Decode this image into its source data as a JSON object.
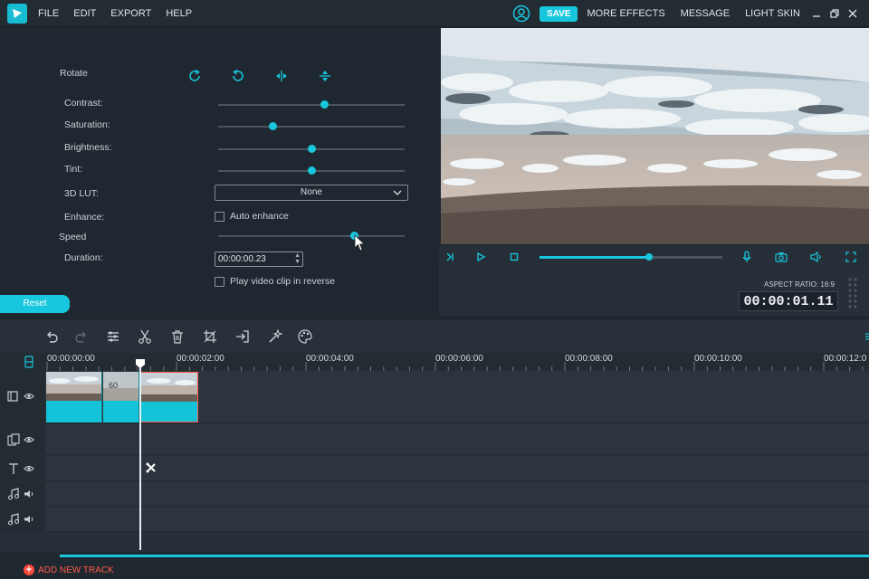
{
  "app": {
    "menu": [
      "FILE",
      "EDIT",
      "EXPORT",
      "HELP"
    ],
    "save_label": "SAVE",
    "links": [
      "MORE EFFECTS",
      "MESSAGE",
      "LIGHT SKIN"
    ],
    "accent": "#18c7dd"
  },
  "panel": {
    "rotate_label": "Rotate",
    "rotate_icons": [
      "rotate-cw-icon",
      "rotate-ccw-icon",
      "flip-horizontal-icon",
      "flip-vertical-icon"
    ],
    "sliders": [
      {
        "label": "Contrast:",
        "value": 0.57
      },
      {
        "label": "Saturation:",
        "value": 0.29
      },
      {
        "label": "Brightness:",
        "value": 0.5
      },
      {
        "label": "Tint:",
        "value": 0.5
      }
    ],
    "lut_label": "3D LUT:",
    "lut_value": "None",
    "enhance_label": "Enhance:",
    "auto_enhance_label": "Auto enhance",
    "speed_label": "Speed",
    "speed_value": 0.73,
    "duration_label": "Duration:",
    "duration_value": "00:00:00.23",
    "reverse_label": "Play video clip in reverse",
    "reset_label": "Reset"
  },
  "player": {
    "progress": 0.6,
    "aspect_ratio": "ASPECT RATIO: 16:9",
    "timecode": "00:00:01.11"
  },
  "timeline": {
    "ticks": [
      "00:00:00:00",
      "00:00:02:00",
      "00:00:04:00",
      "00:00:06:00",
      "00:00:08:00",
      "00:00:10:00",
      "00:00:12:0"
    ],
    "add_track_label": "ADD NEW TRACK",
    "clip_badge": "60"
  }
}
